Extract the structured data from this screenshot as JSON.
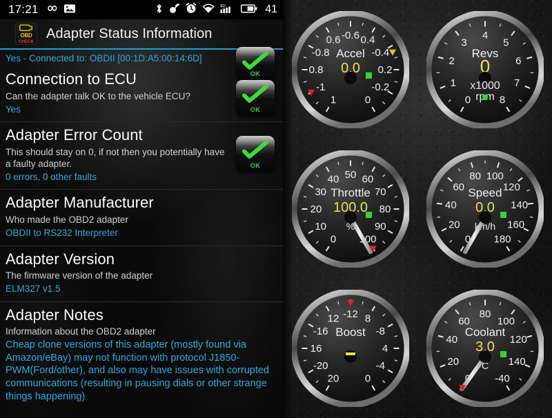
{
  "statusbar": {
    "time": "17:21",
    "left_icons": [
      "infinity-icon",
      "image-icon"
    ],
    "right_icons": [
      "bluetooth-icon",
      "vibrate-icon",
      "alarm-clock-icon",
      "wifi-icon",
      "cellular-signal-4g-icon",
      "battery-icon"
    ],
    "battery_level": "41"
  },
  "header": {
    "app_icon_line1": "OBD",
    "app_icon_line2": "CHECK",
    "title": "Adapter Status Information"
  },
  "connection": {
    "text": "Yes - Connected to: OBDII [00:1D:A5:00:14:6D]",
    "badge_label": "OK",
    "accent_color": "#2ba8e0"
  },
  "sections": [
    {
      "title": "Connection to ECU",
      "desc": "Can the adapter talk OK to the vehicle ECU?",
      "value": "Yes",
      "badge_label": "OK",
      "has_badge": true
    },
    {
      "title": "Adapter Error Count",
      "desc": "This should stay on 0, if not then you potentially have a faulty adapter.",
      "value": "0 errors, 0 other faults",
      "badge_label": "OK",
      "has_badge": true
    },
    {
      "title": "Adapter Manufacturer",
      "desc": "Who made the OBD2 adapter",
      "value": "OBDII to RS232 Interpreter",
      "badge_label": "",
      "has_badge": false
    },
    {
      "title": "Adapter Version",
      "desc": "The firmware version of the adapter",
      "value": "ELM327 v1.5",
      "badge_label": "",
      "has_badge": false
    },
    {
      "title": "Adapter Notes",
      "desc": "Information about the OBD2 adapter",
      "value": "Cheap clone versions of this adapter (mostly found via Amazon/eBay) may not function with protocol J1850-PWM(Ford/other), and also may have issues with corrupted communications (resulting in pausing dials or other strange things happening)",
      "badge_label": "",
      "has_badge": false
    }
  ],
  "gauges": [
    {
      "name": "Accel",
      "value": "0.0",
      "unit": "",
      "unit2": "",
      "ticks": [
        "1",
        "-1",
        "0.8",
        "-0.8",
        "0.6",
        "-0.6",
        "0.4",
        "-0.4",
        "0.2",
        "-0.2",
        "0"
      ],
      "tick_start": 1,
      "tick_end": -1,
      "tick_step": -0.2,
      "decimals": 1,
      "needle_value": 0.0,
      "min_marker": 0.8,
      "max_marker": -0.45,
      "min_marker_color": "#e02020",
      "max_marker_color": "#e8c020",
      "has_green_dot": true,
      "value_color": "#f0e050"
    },
    {
      "name": "Revs",
      "value": "0",
      "unit": "x1000",
      "unit2": "rpm",
      "ticks": [
        "0",
        "1",
        "2",
        "3",
        "4",
        "5",
        "6",
        "7",
        "8"
      ],
      "tick_start": 0,
      "tick_end": 8,
      "tick_step": 1,
      "decimals": 0,
      "needle_value": null,
      "min_marker": null,
      "max_marker": null,
      "has_green_dot": true,
      "green_dot_round": true,
      "value_color": "#f0e050"
    },
    {
      "name": "Throttle",
      "value": "100.0",
      "unit": "%",
      "unit2": "",
      "ticks": [
        "0",
        "10",
        "20",
        "30",
        "40",
        "50",
        "60",
        "70",
        "80",
        "90",
        "100"
      ],
      "tick_start": 0,
      "tick_end": 100,
      "tick_step": 10,
      "decimals": 0,
      "needle_value": 100,
      "min_marker": null,
      "max_marker": 100,
      "max_marker_color": "#e02020",
      "has_green_dot": true,
      "value_color": "#f0e050"
    },
    {
      "name": "Speed",
      "value": "0.0",
      "unit": "km/h",
      "unit2": "",
      "ticks": [
        "0",
        "20",
        "40",
        "60",
        "80",
        "100",
        "120",
        "140",
        "160",
        "180"
      ],
      "tick_start": 0,
      "tick_end": 180,
      "tick_step": 20,
      "decimals": 0,
      "needle_value": 0,
      "min_marker": null,
      "max_marker": null,
      "has_green_dot": true,
      "value_color": "#f0e050"
    },
    {
      "name": "Boost",
      "value": "-",
      "unit": "",
      "unit2": "",
      "ticks": [
        "20",
        "-20",
        "16",
        "-16",
        "12",
        "-12",
        "8",
        "-8",
        "4",
        "-4",
        "0"
      ],
      "tick_start": 20,
      "tick_end": -20,
      "tick_step": -4,
      "decimals": 0,
      "needle_value": null,
      "min_marker": null,
      "max_marker": 0,
      "max_marker_color": "#e02020",
      "has_green_dot": false,
      "value_color": "#f0e050"
    },
    {
      "name": "Coolant",
      "value": "3.0",
      "unit": "C",
      "unit2": "",
      "ticks": [
        "0",
        "20",
        "40",
        "60",
        "80",
        "100",
        "120",
        "140",
        "-40"
      ],
      "tick_start": 0,
      "tick_end": 160,
      "tick_step": 20,
      "tick_override_last": "-40",
      "decimals": 0,
      "needle_value": 3,
      "min_marker": null,
      "max_marker": 0,
      "max_marker_color": "#e02020",
      "has_green_dot": true,
      "value_color": "#f0e050"
    }
  ]
}
